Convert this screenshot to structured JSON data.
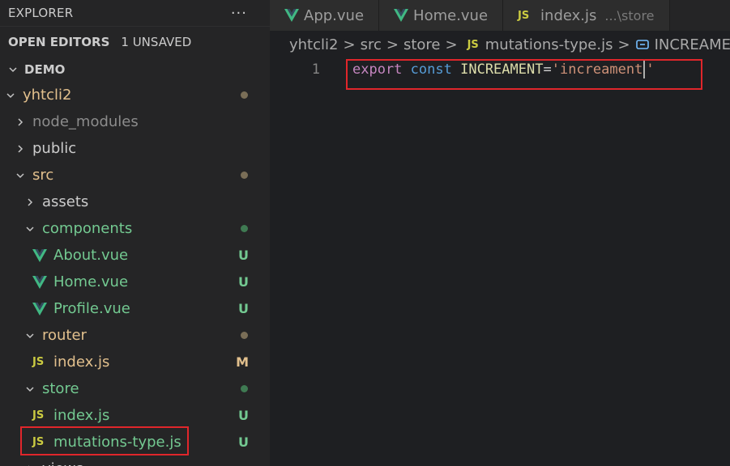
{
  "sidebar": {
    "title": "EXPLORER",
    "more": "···",
    "open_editors": {
      "label": "OPEN EDITORS",
      "badge": "1 UNSAVED"
    },
    "workspace": "DEMO",
    "tree": [
      {
        "label": "yhtcli2",
        "type": "folder",
        "open": true,
        "indent": 0,
        "color": "#e2c08d",
        "decoration": "dot",
        "deco_color": "#7a6e57"
      },
      {
        "label": "node_modules",
        "type": "folder",
        "open": false,
        "indent": 1,
        "color": "#8c8c8c",
        "decoration": "",
        "deco_color": ""
      },
      {
        "label": "public",
        "type": "folder",
        "open": false,
        "indent": 1,
        "color": "#cccccc",
        "decoration": "",
        "deco_color": ""
      },
      {
        "label": "src",
        "type": "folder",
        "open": true,
        "indent": 1,
        "color": "#e2c08d",
        "decoration": "dot",
        "deco_color": "#7a6e57"
      },
      {
        "label": "assets",
        "type": "folder",
        "open": false,
        "indent": 2,
        "color": "#cccccc",
        "decoration": "",
        "deco_color": ""
      },
      {
        "label": "components",
        "type": "folder",
        "open": true,
        "indent": 2,
        "color": "#73c991",
        "decoration": "dot",
        "deco_color": "#3f7a52"
      },
      {
        "label": "About.vue",
        "type": "vue",
        "indent": 3,
        "color": "#73c991",
        "decoration": "U",
        "deco_color": "#73c991"
      },
      {
        "label": "Home.vue",
        "type": "vue",
        "indent": 3,
        "color": "#73c991",
        "decoration": "U",
        "deco_color": "#73c991"
      },
      {
        "label": "Profile.vue",
        "type": "vue",
        "indent": 3,
        "color": "#73c991",
        "decoration": "U",
        "deco_color": "#73c991"
      },
      {
        "label": "router",
        "type": "folder",
        "open": true,
        "indent": 2,
        "color": "#e2c08d",
        "decoration": "dot",
        "deco_color": "#7a6e57"
      },
      {
        "label": "index.js",
        "type": "js",
        "indent": 3,
        "color": "#e2c08d",
        "decoration": "M",
        "deco_color": "#e2c08d"
      },
      {
        "label": "store",
        "type": "folder",
        "open": true,
        "indent": 2,
        "color": "#73c991",
        "decoration": "dot",
        "deco_color": "#3f7a52"
      },
      {
        "label": "index.js",
        "type": "js",
        "indent": 3,
        "color": "#73c991",
        "decoration": "U",
        "deco_color": "#73c991"
      },
      {
        "label": "mutations-type.js",
        "type": "js",
        "indent": 3,
        "color": "#73c991",
        "decoration": "U",
        "deco_color": "#73c991",
        "highlight": true
      },
      {
        "label": "views",
        "type": "folder",
        "open": false,
        "indent": 2,
        "color": "#cccccc",
        "decoration": "",
        "deco_color": ""
      }
    ]
  },
  "tabs": [
    {
      "label": "App.vue",
      "icon": "vue",
      "path": ""
    },
    {
      "label": "Home.vue",
      "icon": "vue",
      "path": ""
    },
    {
      "label": "index.js",
      "icon": "js",
      "path": "...\\store"
    }
  ],
  "js_icon_text": "JS",
  "breadcrumbs": {
    "items": [
      "yhtcli2",
      "src",
      "store",
      "mutations-type.js",
      "INCREAMENT"
    ],
    "separator": ">"
  },
  "editor": {
    "line_number": "1",
    "tokens": {
      "kw_export": "export",
      "kw_const": "const",
      "name": "INCREAMENT",
      "eq": "=",
      "str_open": "'increament",
      "str_close": "'"
    }
  },
  "colors": {
    "vue_green": "#41b883",
    "vue_dark": "#34495e",
    "js_yellow": "#cbcb41",
    "highlight_red": "#e0262b"
  }
}
